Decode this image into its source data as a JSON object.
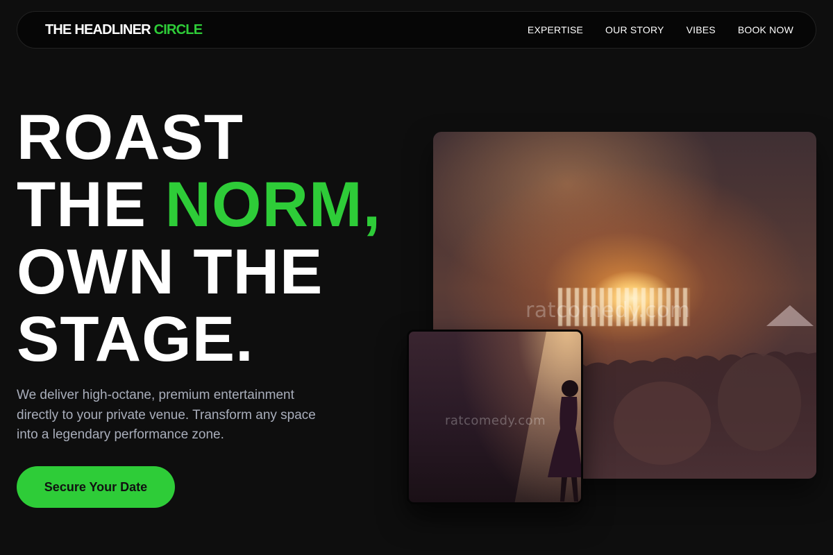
{
  "nav": {
    "brand_main": "THE HEADLINER",
    "brand_accent": "CIRCLE",
    "links": [
      "EXPERTISE",
      "OUR STORY",
      "VIBES",
      "BOOK NOW"
    ]
  },
  "hero": {
    "headline": {
      "line1": "ROAST",
      "line2_plain": "THE",
      "line2_accent": "NORM,",
      "line3": "OWN THE",
      "line4": "STAGE."
    },
    "subtext": "We deliver high-octane, premium entertainment directly to your private venue. Transform any space into a legendary performance zone.",
    "cta_label": "Secure Your Date"
  },
  "images": {
    "concert_watermark": "ratcomedy.com",
    "performer_watermark": "ratcomedy.com"
  },
  "colors": {
    "accent": "#2ecc38",
    "background": "#0e0e0e",
    "subtext": "#a9aebb"
  }
}
